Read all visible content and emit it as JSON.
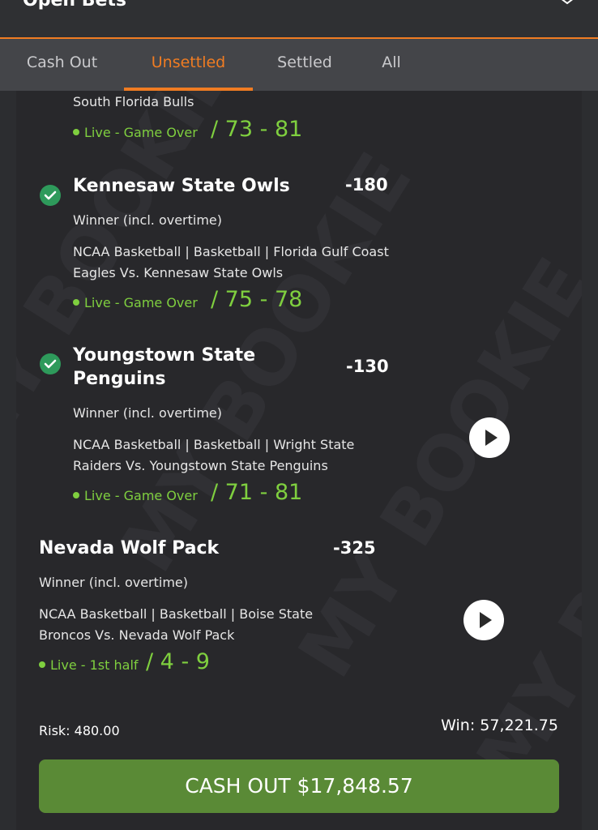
{
  "header": {
    "title": "Open Bets"
  },
  "tabs": [
    {
      "label": "Cash Out"
    },
    {
      "label": "Unsettled"
    },
    {
      "label": "Settled"
    },
    {
      "label": "All"
    }
  ],
  "watermark_text": "MY BOOKIE",
  "bets": [
    {
      "team": "South Florida Bulls",
      "status": "Live - Game Over",
      "score": "/ 73 - 81"
    },
    {
      "team": "Kennesaw State Owls",
      "odds": "-180",
      "market": "Winner (incl. overtime)",
      "description": "NCAA Basketball | Basketball | Florida Gulf Coast Eagles Vs. Kennesaw State Owls",
      "status": "Live - Game Over",
      "score": "/ 75 - 78"
    },
    {
      "team": "Youngstown State Penguins",
      "odds": "-130",
      "market": "Winner (incl. overtime)",
      "description": "NCAA Basketball | Basketball | Wright State Raiders Vs. Youngstown State Penguins",
      "status": "Live - Game Over",
      "score": "/ 71 - 81"
    },
    {
      "team": "Nevada Wolf Pack",
      "odds": "-325",
      "market": "Winner (incl. overtime)",
      "description": "NCAA Basketball | Basketball | Boise State Broncos Vs. Nevada Wolf Pack",
      "status": "Live - 1st half",
      "score": "/ 4 - 9"
    }
  ],
  "summary": {
    "risk": "Risk: 480.00",
    "win": "Win: 57,221.75",
    "cash_out": "CASH OUT $17,848.57"
  },
  "colors": {
    "accent": "#f07c22",
    "live": "#7fcf3f",
    "check": "#2e9a5b",
    "cash_out": "#5a8a36"
  }
}
